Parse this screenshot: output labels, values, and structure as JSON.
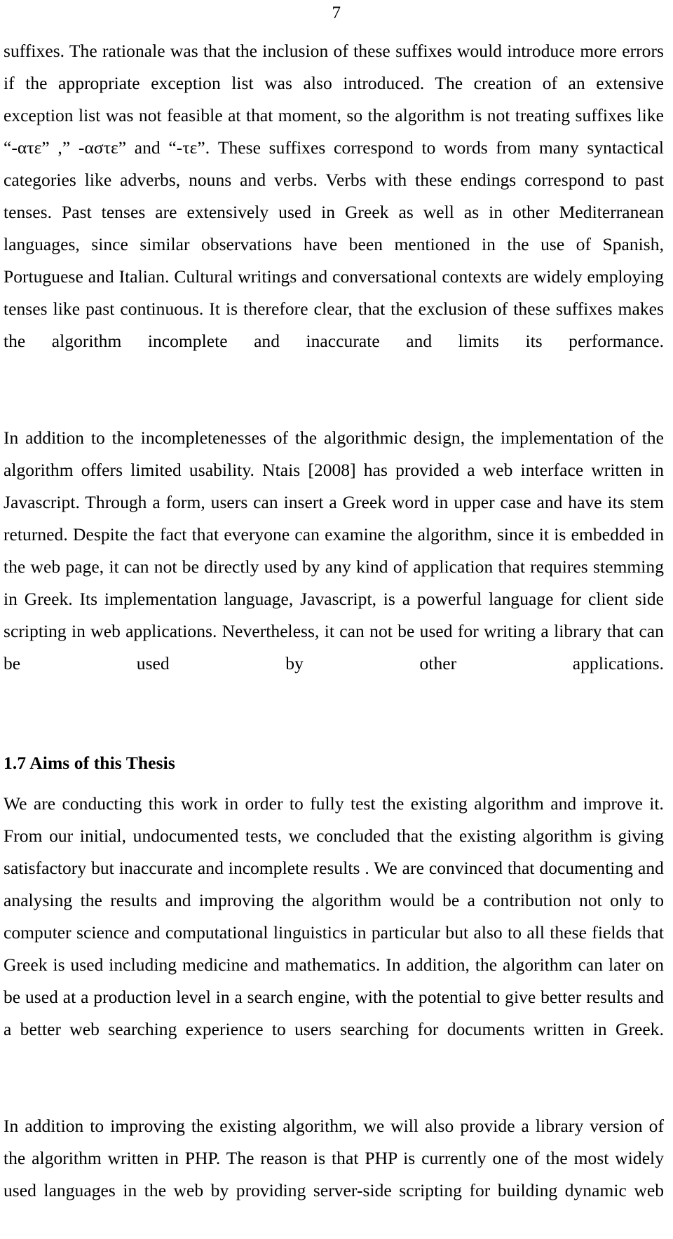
{
  "document": {
    "page_number": "7",
    "blocks": [
      {
        "kind": "paragraph",
        "id": "para-suffix-rationale",
        "text": "suffixes. The rationale was that the inclusion of these suffixes would introduce more errors if the appropriate exception list was also introduced. The creation of an extensive exception list was not feasible at that moment, so the algorithm is not treating suffixes like “-ατε” ,” -αστε” and “-τε”. These suffixes correspond to words from many syntactical categories like adverbs, nouns and verbs. Verbs with these endings correspond to past tenses. Past tenses are extensively used in Greek as well as in other Mediterranean languages, since similar observations have been mentioned in the use of Spanish, Portuguese and Italian. Cultural writings and conversational contexts are widely employing tenses like past continuous. It is therefore clear, that the exclusion of these suffixes makes the algorithm incomplete and inaccurate and limits its performance."
      },
      {
        "kind": "paragraph",
        "id": "para-implementation-usability",
        "text": "In addition to the incompletenesses of the algorithmic design, the implementation of the algorithm offers limited usability. Ntais [2008] has provided a web interface written in Javascript. Through a form, users can insert a Greek word in upper case and have its stem returned. Despite the fact that everyone can examine the algorithm, since it is embedded in the web page, it can not be directly used by any kind of application that requires stemming in Greek. Its implementation language, Javascript, is a powerful language for client side scripting in web applications. Nevertheless, it can not be used for writing a library that can be used by other applications."
      },
      {
        "kind": "heading",
        "id": "heading-aims",
        "text": "1.7 Aims of this Thesis"
      },
      {
        "kind": "paragraph",
        "id": "para-aims-body",
        "text": "We are conducting this work in order to fully test the existing algorithm and improve it. From our initial, undocumented tests, we concluded that the existing algorithm is giving satisfactory but inaccurate and incomplete results . We are convinced that documenting and analysing the results and improving the algorithm would be a contribution not only to computer science and computational linguistics in particular but also to all these fields that Greek is used including medicine and mathematics. In addition, the algorithm can later on be used at a production level in a search engine, with the potential to give better results and a better web searching experience to users searching for documents written in Greek."
      },
      {
        "kind": "paragraph",
        "id": "para-php-library",
        "text": "In addition to improving the existing algorithm, we will also provide a library version of the algorithm written in PHP. The reason is that PHP is currently one of the most widely used languages in the web by providing server-side scripting for building dynamic web"
      }
    ]
  },
  "greek_suffixes": {
    "first": "-ατε",
    "second": "-αστε",
    "third": "-τε"
  },
  "citations": {
    "ntais": "Ntais [2008]"
  },
  "colors": {
    "page_background": "#ffffff",
    "text": "#000000"
  }
}
